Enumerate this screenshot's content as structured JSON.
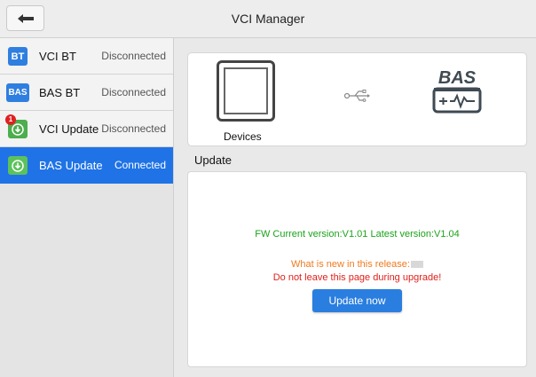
{
  "header": {
    "title": "VCI Manager",
    "back_icon": "back-arrow-icon"
  },
  "sidebar": {
    "items": [
      {
        "icon_text": "BT",
        "label": "VCI BT",
        "status": "Disconnected",
        "active": false
      },
      {
        "icon_text": "BAS",
        "label": "BAS BT",
        "status": "Disconnected",
        "active": false
      },
      {
        "icon_text": "",
        "badge": "1",
        "label": "VCI Update",
        "status": "Disconnected",
        "active": false
      },
      {
        "icon_text": "",
        "label": "BAS Update",
        "status": "Connected",
        "active": true
      }
    ]
  },
  "devices": {
    "label": "Devices",
    "logo_text": "BAS"
  },
  "update": {
    "heading": "Update",
    "fw_line": "FW Current version:V1.01  Latest version:V1.04",
    "whats_new": "What is new in this release:",
    "warning": "Do not leave this page during upgrade!",
    "button_label": "Update now"
  },
  "colors": {
    "accent": "#1f73e6",
    "version_text": "#1aa31a",
    "whats_new_text": "#f07a1e",
    "warning_text": "#e0201a"
  }
}
